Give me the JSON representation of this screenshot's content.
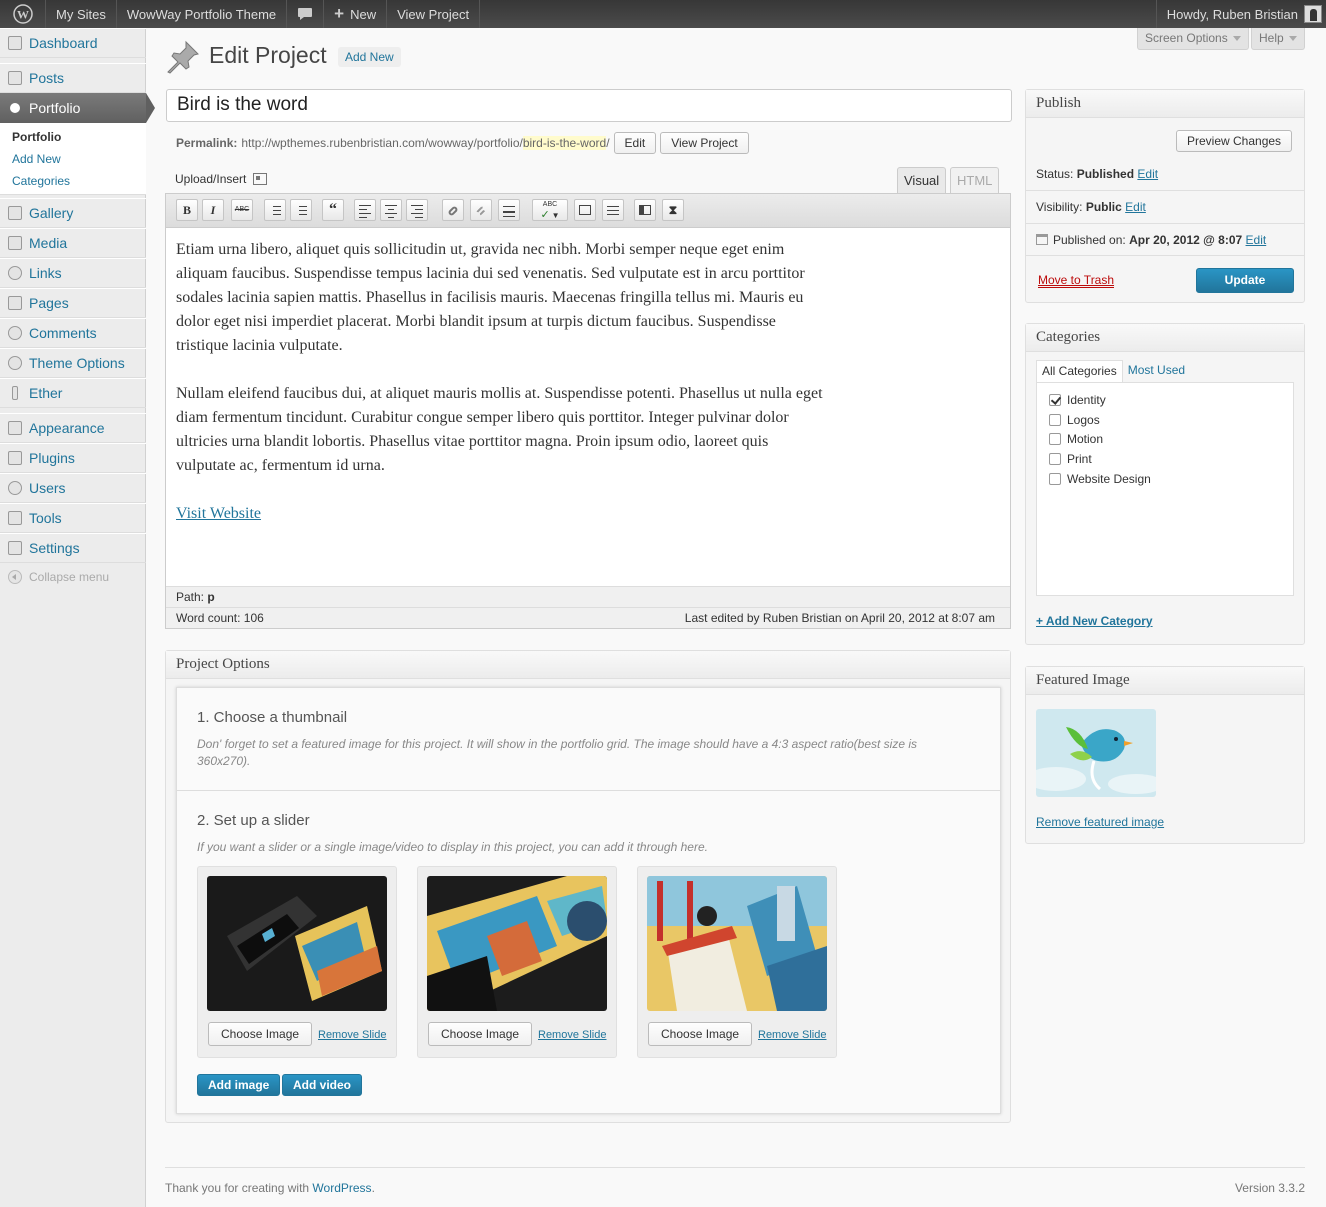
{
  "adminbar": {
    "my_sites": "My Sites",
    "site_name": "WowWay Portfolio Theme",
    "new_label": "New",
    "view_project": "View Project",
    "howdy": "Howdy, Ruben Bristian"
  },
  "sidebar": {
    "items": [
      {
        "label": "Dashboard",
        "icon": "dashboard-icon"
      },
      {
        "label": "Posts",
        "icon": "pin-icon"
      },
      {
        "label": "Portfolio",
        "icon": "eye-icon"
      },
      {
        "label": "Gallery",
        "icon": "pin-icon"
      },
      {
        "label": "Media",
        "icon": "media-icon"
      },
      {
        "label": "Links",
        "icon": "link-icon"
      },
      {
        "label": "Pages",
        "icon": "pages-icon"
      },
      {
        "label": "Comments",
        "icon": "comment-icon"
      },
      {
        "label": "Theme Options",
        "icon": "gear-icon"
      },
      {
        "label": "Ether",
        "icon": "ether-icon"
      },
      {
        "label": "Appearance",
        "icon": "appearance-icon"
      },
      {
        "label": "Plugins",
        "icon": "plugin-icon"
      },
      {
        "label": "Users",
        "icon": "users-icon"
      },
      {
        "label": "Tools",
        "icon": "tools-icon"
      },
      {
        "label": "Settings",
        "icon": "settings-icon"
      }
    ],
    "submenu": [
      "Portfolio",
      "Add New",
      "Categories"
    ],
    "collapse": "Collapse menu"
  },
  "header": {
    "title": "Edit Project",
    "add_new": "Add New",
    "screen_options": "Screen Options",
    "help": "Help"
  },
  "post": {
    "title": "Bird is the word",
    "permalink_label": "Permalink:",
    "permalink_base": "http://wpthemes.rubenbristian.com/wowway/portfolio/",
    "slug": "bird-is-the-word",
    "permalink_tail": "/",
    "edit_btn": "Edit",
    "view_btn": "View Project"
  },
  "editor": {
    "upload_insert": "Upload/Insert",
    "tab_visual": "Visual",
    "tab_html": "HTML",
    "paragraph1": "Etiam urna libero, aliquet quis sollicitudin ut, gravida nec nibh. Morbi semper neque eget enim aliquam faucibus. Suspendisse tempus lacinia dui sed venenatis. Sed vulputate est in arcu porttitor sodales lacinia sapien mattis. Phasellus in facilisis mauris. Maecenas fringilla tellus mi. Mauris eu dolor eget nisi imperdiet placerat. Morbi blandit ipsum at turpis dictum faucibus. Suspendisse tristique lacinia vulputate.",
    "paragraph2": "Nullam eleifend faucibus dui, at aliquet mauris mollis at. Suspendisse potenti. Phasellus ut nulla eget diam fermentum tincidunt. Curabitur congue semper libero quis porttitor. Integer pulvinar dolor ultricies urna blandit lobortis. Phasellus vitae porttitor magna. Proin ipsum odio, laoreet quis vulputate ac, fermentum id urna.",
    "link": "Visit Website",
    "path_label": "Path:",
    "path_value": "p",
    "word_count": "Word count: 106",
    "last_edited": "Last edited by Ruben Bristian on April 20, 2012 at 8:07 am"
  },
  "project_options": {
    "heading": "Project Options",
    "step1_title": "1. Choose a thumbnail",
    "step1_desc": "Don' forget to set a featured image for this project. It will show in the portfolio grid. The image should have a 4:3 aspect ratio(best size is 360x270).",
    "step2_title": "2. Set up a slider",
    "step2_desc": "If you want a slider or a single image/video to display in this project, you can add it through here.",
    "choose_image": "Choose Image",
    "remove_slide": "Remove Slide",
    "add_image": "Add image",
    "add_video": "Add video"
  },
  "publish": {
    "heading": "Publish",
    "preview": "Preview Changes",
    "status_label": "Status:",
    "status_value": "Published",
    "visibility_label": "Visibility:",
    "visibility_value": "Public",
    "published_label": "Published on:",
    "published_value": "Apr 20, 2012 @ 8:07",
    "edit": "Edit",
    "trash": "Move to Trash",
    "update": "Update"
  },
  "categories": {
    "heading": "Categories",
    "tab_all": "All Categories",
    "tab_most": "Most Used",
    "items": [
      {
        "label": "Identity",
        "checked": true
      },
      {
        "label": "Logos",
        "checked": false
      },
      {
        "label": "Motion",
        "checked": false
      },
      {
        "label": "Print",
        "checked": false
      },
      {
        "label": "Website Design",
        "checked": false
      }
    ],
    "add_new": "+ Add New Category"
  },
  "featured": {
    "heading": "Featured Image",
    "remove": "Remove featured image"
  },
  "footer": {
    "thanks": "Thank you for creating with",
    "wp": "WordPress",
    "period": ".",
    "version": "Version 3.3.2"
  },
  "colors": {
    "accent": "#21759b",
    "trash": "#bc0b0b",
    "adminbar": "#464646"
  }
}
